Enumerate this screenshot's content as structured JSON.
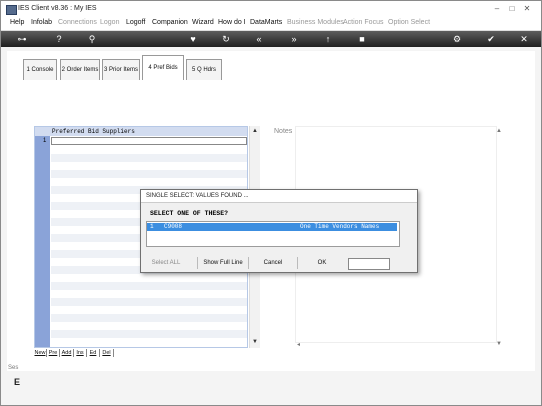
{
  "window": {
    "title": "IES Client v8.36 : My IES"
  },
  "window_controls": [
    "–",
    "□",
    "✕"
  ],
  "menu": [
    {
      "label": "Help",
      "enabled": true
    },
    {
      "label": "Infolab",
      "enabled": true
    },
    {
      "label": "Connections",
      "enabled": false
    },
    {
      "label": "Logon",
      "enabled": false
    },
    {
      "label": "Logoff",
      "enabled": true
    },
    {
      "label": "Companion",
      "enabled": true
    },
    {
      "label": "Wizard",
      "enabled": true
    },
    {
      "label": "How do I",
      "enabled": true
    },
    {
      "label": "DataMarts",
      "enabled": true
    },
    {
      "label": "Business Modules",
      "enabled": false
    },
    {
      "label": "Action Focus",
      "enabled": false
    },
    {
      "label": "Option Select",
      "enabled": false
    }
  ],
  "toolbar_icons": [
    "key-icon",
    "help-icon",
    "search-icon",
    "heart-icon",
    "refresh-icon",
    "rewind-icon",
    "fast-forward-icon",
    "upload-icon",
    "stop-icon",
    "settings-icon",
    "check-icon",
    "close-icon"
  ],
  "tabs": [
    {
      "label": "1 Console",
      "active": false
    },
    {
      "label": "2 Order Items",
      "active": false
    },
    {
      "label": "3 Prior Items",
      "active": false
    },
    {
      "label": "4 Pref Bids",
      "active": true
    },
    {
      "label": "5 Q Hdrs",
      "active": false
    }
  ],
  "grid": {
    "header": "Preferred Bid Suppliers",
    "rows": [
      "1"
    ]
  },
  "grid_buttons": [
    "New",
    "Pre",
    "Add",
    "Ins",
    "Ed",
    "Del"
  ],
  "notes": {
    "label": "Notes"
  },
  "status": {
    "tag": "Ses",
    "glyph": "E"
  },
  "dialog": {
    "title": "SINGLE SELECT: VALUES FOUND ...",
    "heading": "SELECT ONE OF THESE?",
    "rows": [
      {
        "num": "1",
        "code": "C9008",
        "desc": "One Time Vendors Names"
      }
    ],
    "buttons": [
      {
        "label": "Select ALL",
        "enabled": false
      },
      {
        "label": "Show Full Line",
        "enabled": true
      },
      {
        "label": "Cancel",
        "enabled": true
      },
      {
        "label": "OK",
        "enabled": true
      }
    ],
    "input_value": ""
  }
}
